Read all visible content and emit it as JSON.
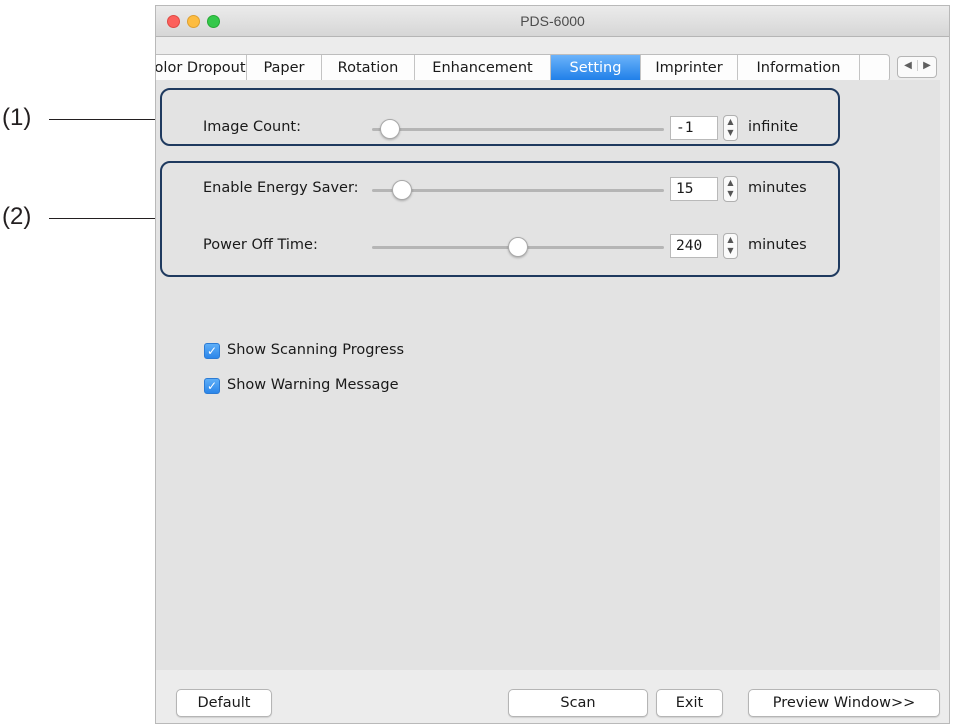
{
  "callouts": {
    "c1": "(1)",
    "c2": "(2)"
  },
  "window": {
    "title": "PDS-6000"
  },
  "tabs": [
    {
      "label": "Color Dropout",
      "active": false
    },
    {
      "label": "Paper",
      "active": false
    },
    {
      "label": "Rotation",
      "active": false
    },
    {
      "label": "Enhancement",
      "active": false
    },
    {
      "label": "Setting",
      "active": true
    },
    {
      "label": "Imprinter",
      "active": false
    },
    {
      "label": "Information",
      "active": false
    }
  ],
  "settings": {
    "image_count": {
      "label": "Image Count:",
      "value": "-1",
      "unit": "infinite"
    },
    "energy_saver": {
      "label": "Enable Energy Saver:",
      "value": "15",
      "unit": "minutes"
    },
    "power_off": {
      "label": "Power Off Time:",
      "value": "240",
      "unit": "minutes"
    }
  },
  "options": {
    "show_progress": {
      "label": "Show Scanning Progress",
      "checked": true
    },
    "show_warning": {
      "label": "Show Warning Message",
      "checked": true
    }
  },
  "buttons": {
    "default": "Default",
    "scan": "Scan",
    "exit": "Exit",
    "preview": "Preview Window>>"
  },
  "icons": {
    "tab_left": "triangle-left-icon",
    "tab_right": "triangle-right-icon",
    "stepper": "up-down-stepper-icon",
    "check": "checkmark-icon"
  },
  "colors": {
    "accent": "#1d7ee8",
    "callout_border": "#1f3a5f"
  }
}
